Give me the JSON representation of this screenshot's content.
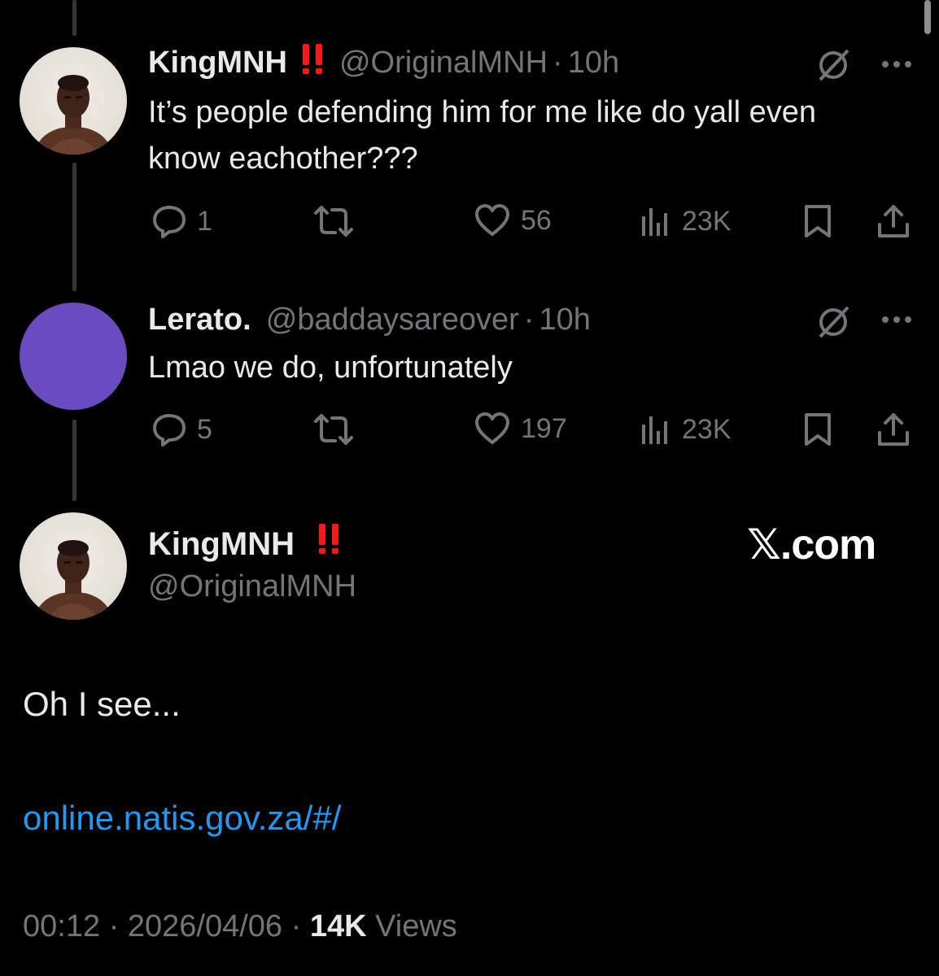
{
  "tweets": [
    {
      "display_name": "KingMNH",
      "badge": "‼️",
      "handle": "@OriginalMNH",
      "separator": "·",
      "time": "10h",
      "text": "It’s people defending him for me like do yall even know eachother???",
      "replies": "1",
      "likes": "56",
      "views": "23K"
    },
    {
      "display_name": "Lerato.",
      "handle": "@baddaysareover",
      "separator": "·",
      "time": "10h",
      "text": "Lmao we do, unfortunately",
      "replies": "5",
      "likes": "197",
      "views": "23K"
    }
  ],
  "main_tweet": {
    "display_name": "KingMNH",
    "badge": "‼️",
    "handle": "@OriginalMNH",
    "watermark": "𝕏.com",
    "text": "Oh I see...",
    "link": "online.natis.gov.za/#/",
    "time": "00:12",
    "sep1": "·",
    "date": "2026/04/06",
    "sep2": "·",
    "views_count": "14K",
    "views_label": "Views"
  },
  "colors": {
    "background": "#000000",
    "text": "#e7e9ea",
    "muted": "#71767b",
    "link": "#1d9bf0",
    "badge": "#f91818",
    "avatar_purple": "#6b4bc0"
  },
  "icons": [
    "reply-icon",
    "retweet-icon",
    "like-icon",
    "views-icon",
    "bookmark-icon",
    "share-icon",
    "grok-icon",
    "more-icon"
  ]
}
